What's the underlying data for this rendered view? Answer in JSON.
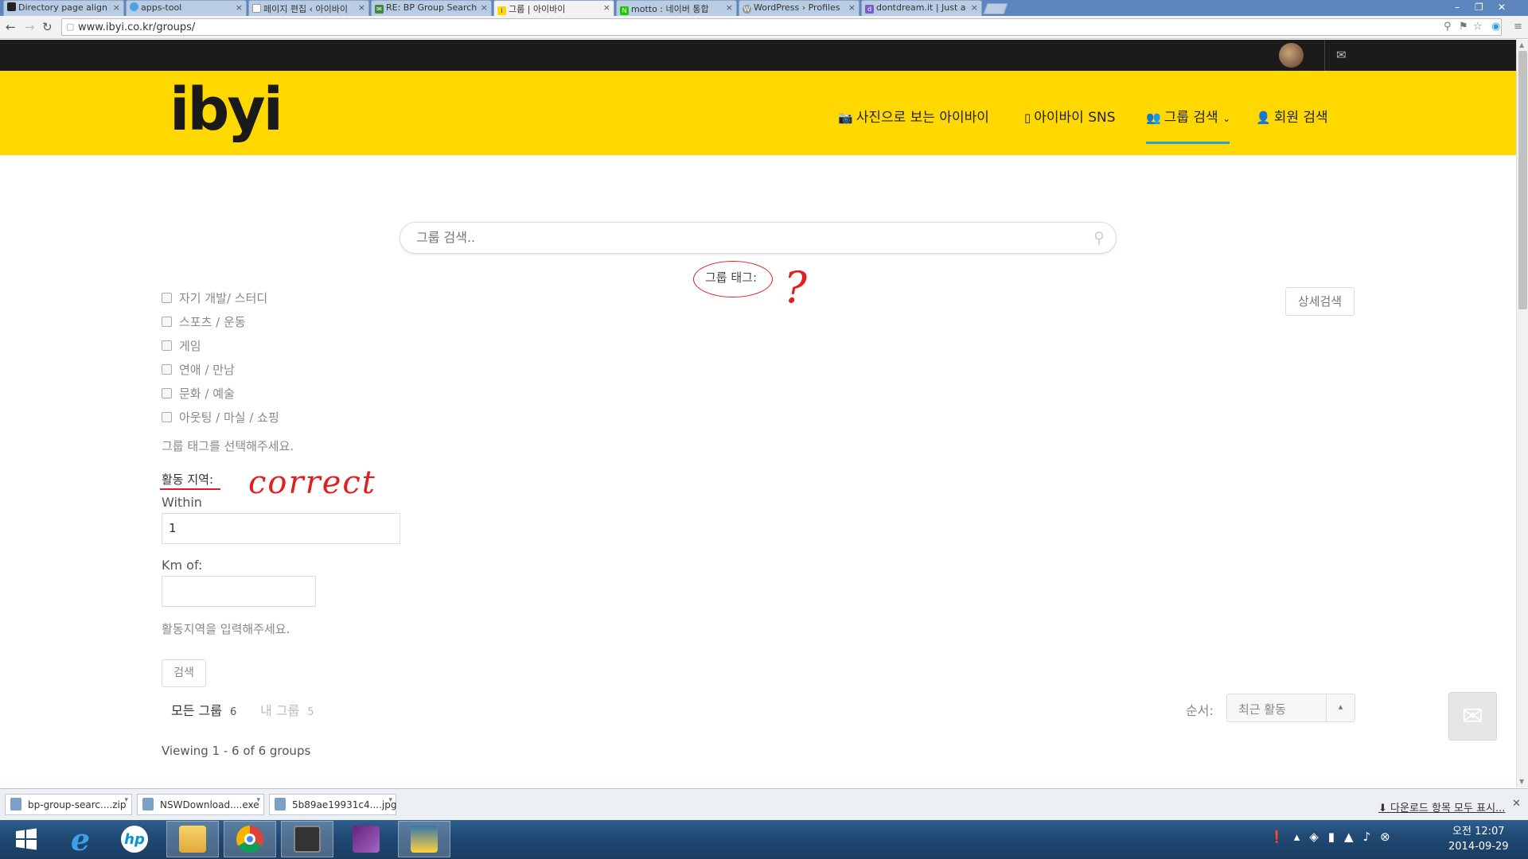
{
  "browser": {
    "tabs": [
      {
        "label": "Directory page align",
        "icon": "github-icon"
      },
      {
        "label": "apps-tool",
        "icon": "circle-icon"
      },
      {
        "label": "페이지 편집 ‹ 아이바이",
        "icon": "page-icon"
      },
      {
        "label": "RE: BP Group Search",
        "icon": "mail-icon"
      },
      {
        "label": "그룹 | 아이바이",
        "icon": "ibyi-icon"
      },
      {
        "label": "motto : 네이버 통합",
        "icon": "naver-icon"
      },
      {
        "label": "WordPress › Profiles",
        "icon": "wordpress-icon"
      },
      {
        "label": "dontdream.it | Just a",
        "icon": "dd-icon"
      }
    ],
    "active_tab": 4,
    "url": "www.ibyi.co.kr/groups/"
  },
  "nav": {
    "logo": "ibyi",
    "items": [
      {
        "label": "사진으로 보는 아이바이",
        "icon": "camera-icon"
      },
      {
        "label": "아이바이 SNS",
        "icon": "mobile-icon"
      },
      {
        "label": "그룹 검색",
        "icon": "users-icon"
      },
      {
        "label": "회원 검색",
        "icon": "user-icon"
      }
    ]
  },
  "search": {
    "placeholder": "그룹 검색.."
  },
  "tags": {
    "label": "그룹 태그:",
    "advanced_button": "상세검색",
    "options": [
      "자기 개발/ 스터디",
      "스포츠 / 운동",
      "게임",
      "연애 / 만남",
      "문화 / 예술",
      "아웃팅 / 마실 / 쇼핑"
    ],
    "hint": "그룹 태그를 선택해주세요."
  },
  "region": {
    "label": "활동 지역:",
    "within_label": "Within",
    "within_value": "1",
    "km_label": "Km of:",
    "km_value": "",
    "hint": "활동지역을 입력해주세요.",
    "search_button": "검색"
  },
  "annotations": {
    "question": "?",
    "correct": "correct"
  },
  "groups": {
    "all_label": "모든 그룹",
    "all_count": "6",
    "mine_label": "내 그룹",
    "mine_count": "5",
    "order_label": "순서:",
    "order_value": "최근 활동",
    "viewing": "Viewing 1 - 6 of 6 groups"
  },
  "downloads": {
    "items": [
      "bp-group-searc....zip",
      "NSWDownload....exe",
      "5b89ae19931c4....jpg"
    ],
    "show_all": "다운로드 항목 모두 표시..."
  },
  "taskbar": {
    "apps": [
      "windows-start-icon",
      "internet-explorer-icon",
      "hp-icon",
      "file-explorer-icon",
      "chrome-icon",
      "app-icon",
      "visual-studio-icon",
      "python-icon"
    ],
    "time": "오전 12:07",
    "date": "2014-09-29"
  },
  "colors": {
    "accent": "#ffd800",
    "topbar": "#1b1b1b",
    "annotation": "#e02020"
  }
}
